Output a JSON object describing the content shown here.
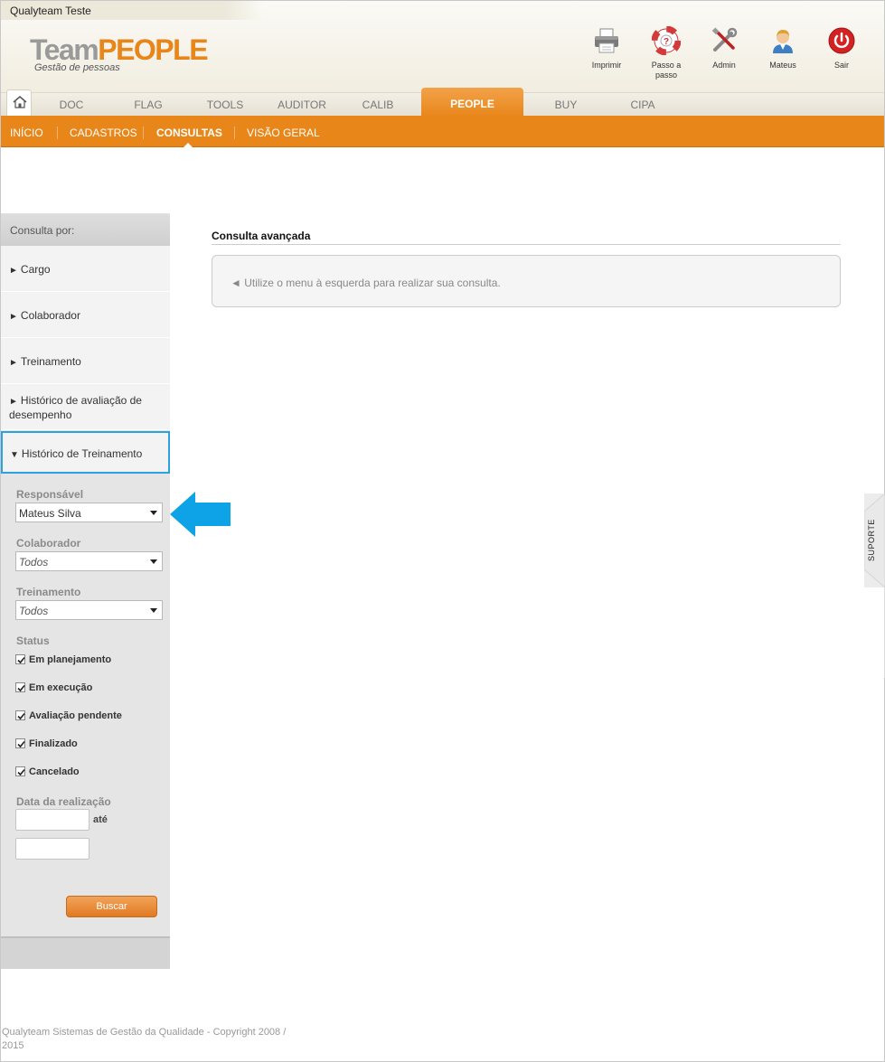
{
  "header": {
    "company": "Qualyteam Teste",
    "logo_team": "Team",
    "logo_people": "PEOPLE",
    "logo_sub": "Gestão de pessoas",
    "actions": [
      {
        "label": "Imprimir",
        "icon": "printer-icon"
      },
      {
        "label": "Passo a\npasso",
        "icon": "lifebuoy-icon"
      },
      {
        "label": "Admin",
        "icon": "tools-icon"
      },
      {
        "label": "Mateus",
        "icon": "user-icon"
      },
      {
        "label": "Sair",
        "icon": "power-icon"
      }
    ]
  },
  "tabs": [
    "DOC",
    "FLAG",
    "TOOLS",
    "AUDITOR",
    "CALIB",
    "PEOPLE",
    "BUY",
    "CIPA"
  ],
  "active_tab": "PEOPLE",
  "subnav": [
    "INÍCIO",
    "CADASTROS",
    "CONSULTAS",
    "VISÃO GERAL"
  ],
  "active_subnav": "CONSULTAS",
  "sidebar": {
    "heading": "Consulta por:",
    "items": [
      {
        "label": "Cargo",
        "arrow": "►"
      },
      {
        "label": "Colaborador",
        "arrow": "►"
      },
      {
        "label": "Treinamento",
        "arrow": "►"
      },
      {
        "label": "Histórico de avaliação de desempenho",
        "arrow": "►"
      },
      {
        "label": "Histórico de Treinamento",
        "arrow": "▼"
      }
    ],
    "filters": {
      "responsavel_label": "Responsável",
      "responsavel_value": "Mateus Silva",
      "colaborador_label": "Colaborador",
      "colaborador_value": "Todos",
      "treinamento_label": "Treinamento",
      "treinamento_value": "Todos",
      "status_label": "Status",
      "status_options": [
        {
          "label": "Em planejamento",
          "checked": true
        },
        {
          "label": "Em execução",
          "checked": true
        },
        {
          "label": "Avaliação pendente",
          "checked": true
        },
        {
          "label": "Finalizado",
          "checked": true
        },
        {
          "label": "Cancelado",
          "checked": true
        }
      ],
      "date_label": "Data da realização",
      "date_sep": "até",
      "submit": "Buscar"
    }
  },
  "main": {
    "title": "Consulta avançada",
    "info": "◄ Utilize o menu à esquerda para realizar sua consulta."
  },
  "support": "SUPORTE",
  "footer": "Qualyteam Sistemas de Gestão da Qualidade - Copyright 2008 / 2015",
  "colors": {
    "accent": "#e8861a",
    "highlight": "#2ba2dd"
  }
}
